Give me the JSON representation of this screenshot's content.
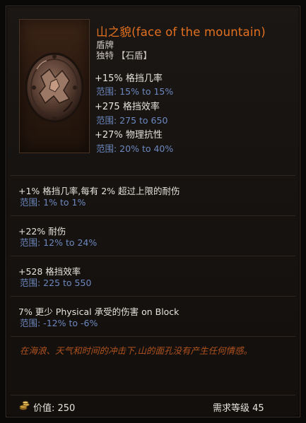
{
  "item": {
    "name": "山之貌(face of the mountain)",
    "type": "盾牌",
    "rarity": "独特 【石盾】",
    "base_stats": [
      {
        "text": "+15% 格挡几率",
        "range": "范围: 15% to 15%"
      },
      {
        "text": "+275 格挡效率",
        "range": "范围: 275 to 650"
      },
      {
        "text": "+27% 物理抗性",
        "range": "范围: 20% to 40%"
      }
    ]
  },
  "affixes": [
    {
      "text": "+1% 格挡几率,每有 2% 超过上限的耐伤",
      "range": "范围: 1% to 1%"
    },
    {
      "text": "+22% 耐伤",
      "range": "范围: 12% to 24%"
    },
    {
      "text": "+528 格挡效率",
      "range": "范围: 225 to 550"
    },
    {
      "text": "7% 更少 Physical 承受的伤害 on Block",
      "range": "范围: -12% to -6%"
    }
  ],
  "flavor_text": "在海浪、天气和时间的冲击下,山的面孔没有产生任何情感。",
  "footer": {
    "price": "价值: 250",
    "level_requirement": "需求等级 45"
  },
  "colors": {
    "unique_name": "#e3701e",
    "range_text": "#6d88bf",
    "flavor": "#b0521d",
    "stat_text": "#e6e2dc"
  },
  "icons": {
    "item_image": "stone-shield-icon",
    "price": "gold-coins-icon"
  }
}
